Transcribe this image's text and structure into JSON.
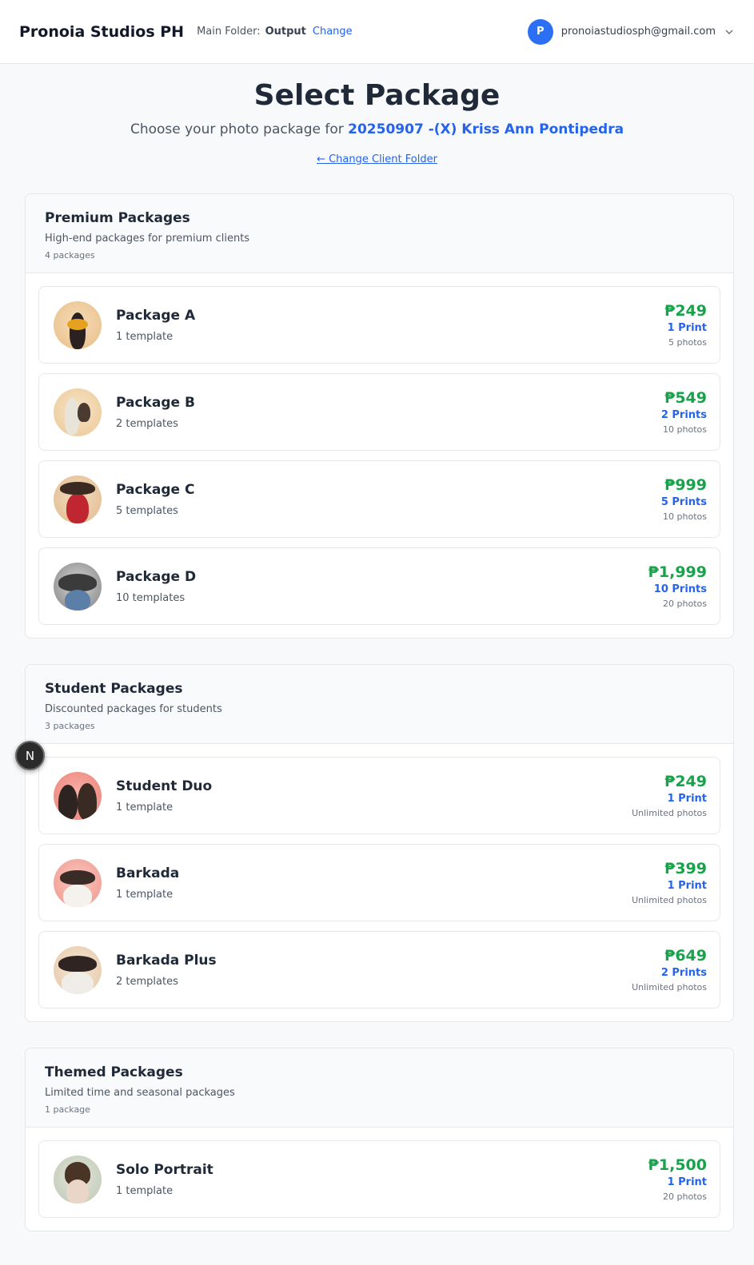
{
  "topbar": {
    "brand": "Pronoia Studios PH",
    "folder_label": "Main Folder:",
    "folder_name": "Output",
    "change_label": "Change",
    "avatar_initial": "P",
    "email": "pronoiastudiosph@gmail.com"
  },
  "header": {
    "title": "Select Package",
    "subtitle_prefix": "Choose your photo package for",
    "client_name": "20250907 -(X) Kriss Ann Pontipedra",
    "back_link": "← Change Client Folder"
  },
  "sections": [
    {
      "title": "Premium Packages",
      "description": "High-end packages for premium clients",
      "count": "4 packages",
      "packages": [
        {
          "name": "Package A",
          "templates": "1 template",
          "price": "₱249",
          "prints": "1 Print",
          "photos": "5 photos"
        },
        {
          "name": "Package B",
          "templates": "2 templates",
          "price": "₱549",
          "prints": "2 Prints",
          "photos": "10 photos"
        },
        {
          "name": "Package C",
          "templates": "5 templates",
          "price": "₱999",
          "prints": "5 Prints",
          "photos": "10 photos"
        },
        {
          "name": "Package D",
          "templates": "10 templates",
          "price": "₱1,999",
          "prints": "10 Prints",
          "photos": "20 photos"
        }
      ]
    },
    {
      "title": "Student Packages",
      "description": "Discounted packages for students",
      "count": "3 packages",
      "packages": [
        {
          "name": "Student Duo",
          "templates": "1 template",
          "price": "₱249",
          "prints": "1 Print",
          "photos": "Unlimited photos"
        },
        {
          "name": "Barkada",
          "templates": "1 template",
          "price": "₱399",
          "prints": "1 Print",
          "photos": "Unlimited photos"
        },
        {
          "name": "Barkada Plus",
          "templates": "2 templates",
          "price": "₱649",
          "prints": "2 Prints",
          "photos": "Unlimited photos"
        }
      ]
    },
    {
      "title": "Themed Packages",
      "description": "Limited time and seasonal packages",
      "count": "1 package",
      "packages": [
        {
          "name": "Solo Portrait",
          "templates": "1 template",
          "price": "₱1,500",
          "prints": "1 Print",
          "photos": "20 photos"
        }
      ]
    }
  ],
  "dev_badge": "N",
  "colors": {
    "accent": "#2563eb",
    "price": "#16a34a",
    "avatar": "#2b6ff3"
  }
}
